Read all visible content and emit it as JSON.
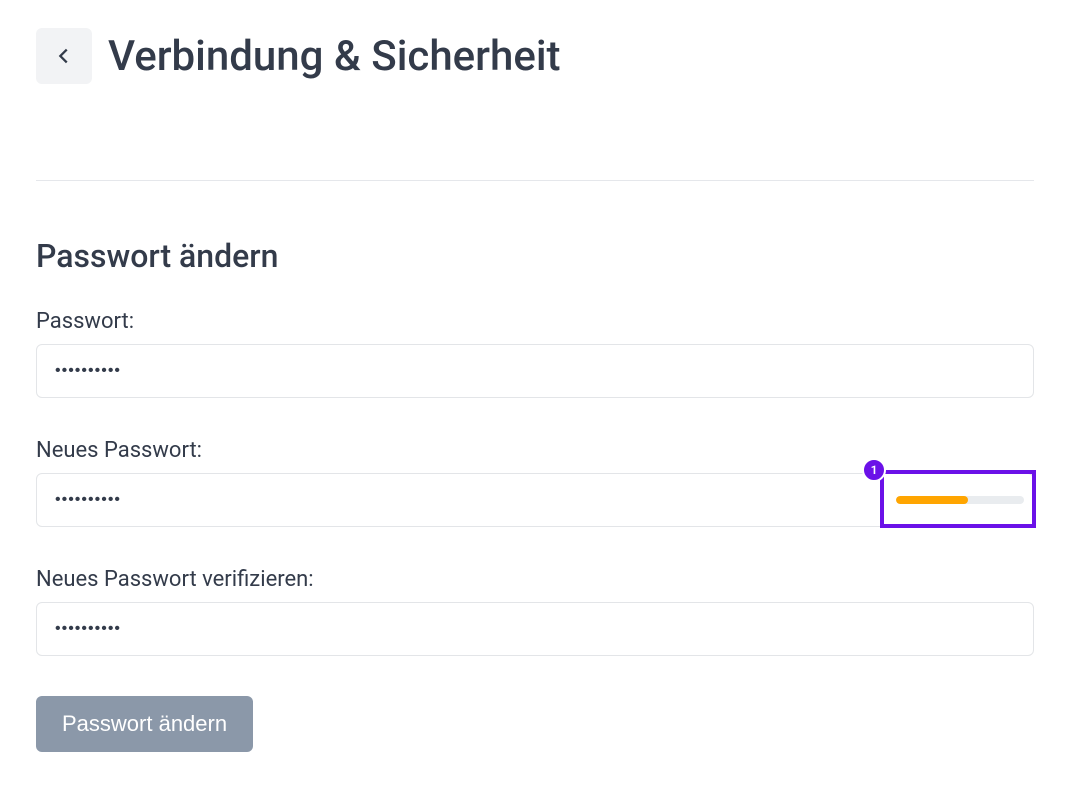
{
  "header": {
    "title": "Verbindung & Sicherheit"
  },
  "section": {
    "title": "Passwort ändern"
  },
  "fields": {
    "current": {
      "label": "Passwort:",
      "value": "••••••••••"
    },
    "new": {
      "label": "Neues Passwort:",
      "value": "••••••••••",
      "strength_percent": 56,
      "strength_color": "#ffa500"
    },
    "verify": {
      "label": "Neues Passwort verifizieren:",
      "value": "••••••••••"
    }
  },
  "submit": {
    "label": "Passwort ändern"
  },
  "annotation": {
    "badge": "1"
  }
}
